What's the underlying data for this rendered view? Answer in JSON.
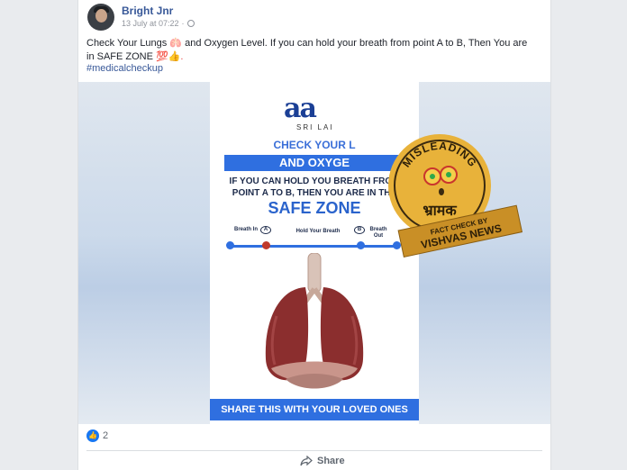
{
  "post": {
    "author": "Bright Jnr",
    "timestamp": "13 July at 07:22",
    "separator": "·",
    "text_before": "Check Your Lungs",
    "emoji_lungs": "🫁",
    "text_middle": "and Oxygen Level. If you can hold your breath from point A to B, Then You are in SAFE ZONE",
    "emoji_end": "💯👍.",
    "hashtag": "#medicalcheckup"
  },
  "poster": {
    "logo": "aa",
    "logo_sub": "SRI LAI",
    "check_line": "CHECK YOUR L",
    "band_line": "AND OXYGE",
    "hold_line1": "IF YOU CAN HOLD YOU BREATH FROM",
    "hold_line2": "POINT A TO B, THEN YOU ARE IN THE",
    "safe_zone": "SAFE ZONE",
    "timeline": {
      "breath_in": "Breath In",
      "a": "A",
      "hold": "Hold Your Breath",
      "b": "B",
      "breath_out": "Breath Out"
    },
    "share_band": "SHARE THIS WITH YOUR LOVED ONES"
  },
  "badge": {
    "top": "MISLEADING",
    "hindi": "भ्रामक",
    "ribbon1": "FACT CHECK BY",
    "ribbon2": "VISHVAS NEWS"
  },
  "footer": {
    "reaction_count": "2",
    "share_label": "Share"
  },
  "colors": {
    "link": "#385898",
    "accent": "#2f6fe0",
    "badge_gold": "#e8b23a"
  }
}
